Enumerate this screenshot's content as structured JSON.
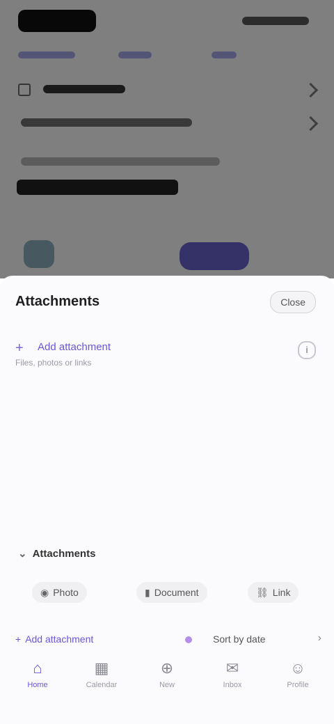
{
  "sheet": {
    "title": "Attachments",
    "close_label": "Close",
    "add_link_label": "Add attachment",
    "add_link_sub": "Files, photos or links",
    "info_icon": "info-icon"
  },
  "section": {
    "heading": "Attachments",
    "pills": [
      {
        "icon": "camera-icon",
        "label": "Photo"
      },
      {
        "icon": "file-icon",
        "label": "Document"
      },
      {
        "icon": "link-icon",
        "label": "Link"
      }
    ]
  },
  "footer": {
    "left_label": "Add attachment",
    "right_label": "Sort by date"
  },
  "bottom_nav": [
    {
      "icon": "home-icon",
      "label": "Home",
      "active": true
    },
    {
      "icon": "calendar-icon",
      "label": "Calendar",
      "active": false
    },
    {
      "icon": "add-icon",
      "label": "New",
      "active": false
    },
    {
      "icon": "inbox-icon",
      "label": "Inbox",
      "active": false
    },
    {
      "icon": "profile-icon",
      "label": "Profile",
      "active": false
    }
  ]
}
